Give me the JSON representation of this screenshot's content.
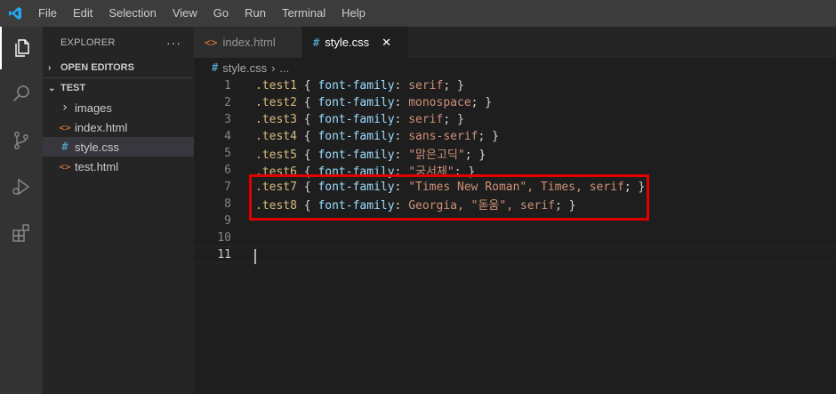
{
  "menu": [
    "File",
    "Edit",
    "Selection",
    "View",
    "Go",
    "Run",
    "Terminal",
    "Help"
  ],
  "explorer": {
    "title": "EXPLORER",
    "more": "···",
    "open_editors": "OPEN EDITORS",
    "folder": "TEST",
    "items": [
      {
        "label": "images",
        "icon": "›",
        "type": "folder"
      },
      {
        "label": "index.html",
        "icon": "<>",
        "type": "html"
      },
      {
        "label": "style.css",
        "icon": "#",
        "type": "css"
      },
      {
        "label": "test.html",
        "icon": "<>",
        "type": "html"
      }
    ]
  },
  "tabs": [
    {
      "label": "index.html",
      "icon": "<>"
    },
    {
      "label": "style.css",
      "icon": "#",
      "close": "✕"
    }
  ],
  "breadcrumb": {
    "icon": "#",
    "file": "style.css",
    "sep": "›",
    "more": "..."
  },
  "code_lines": [
    {
      "n": "1",
      "sel": ".test1",
      "prop": "font-family",
      "val": "serif"
    },
    {
      "n": "2",
      "sel": ".test2",
      "prop": "font-family",
      "val": "monospace"
    },
    {
      "n": "3",
      "sel": ".test3",
      "prop": "font-family",
      "val": "serif"
    },
    {
      "n": "4",
      "sel": ".test4",
      "prop": "font-family",
      "val": "sans-serif"
    },
    {
      "n": "5",
      "sel": ".test5",
      "prop": "font-family",
      "val": "\"맑은고딕\""
    },
    {
      "n": "6",
      "sel": ".test6",
      "prop": "font-family",
      "val": "\"궁서체\""
    },
    {
      "n": "7",
      "sel": ".test7",
      "prop": "font-family",
      "val": "\"Times New Roman\", Times, serif"
    },
    {
      "n": "8",
      "sel": ".test8",
      "prop": "font-family",
      "val": "Georgia, \"돋움\", serif"
    },
    {
      "n": "9"
    },
    {
      "n": "10"
    },
    {
      "n": "11"
    }
  ],
  "colors": {
    "accent": "#007acc",
    "highlight": "#e00000",
    "selector": "#d7ba7d",
    "property": "#9cdcfe",
    "value": "#ce9178",
    "css_icon": "#519aba",
    "html_icon": "#e37933"
  }
}
